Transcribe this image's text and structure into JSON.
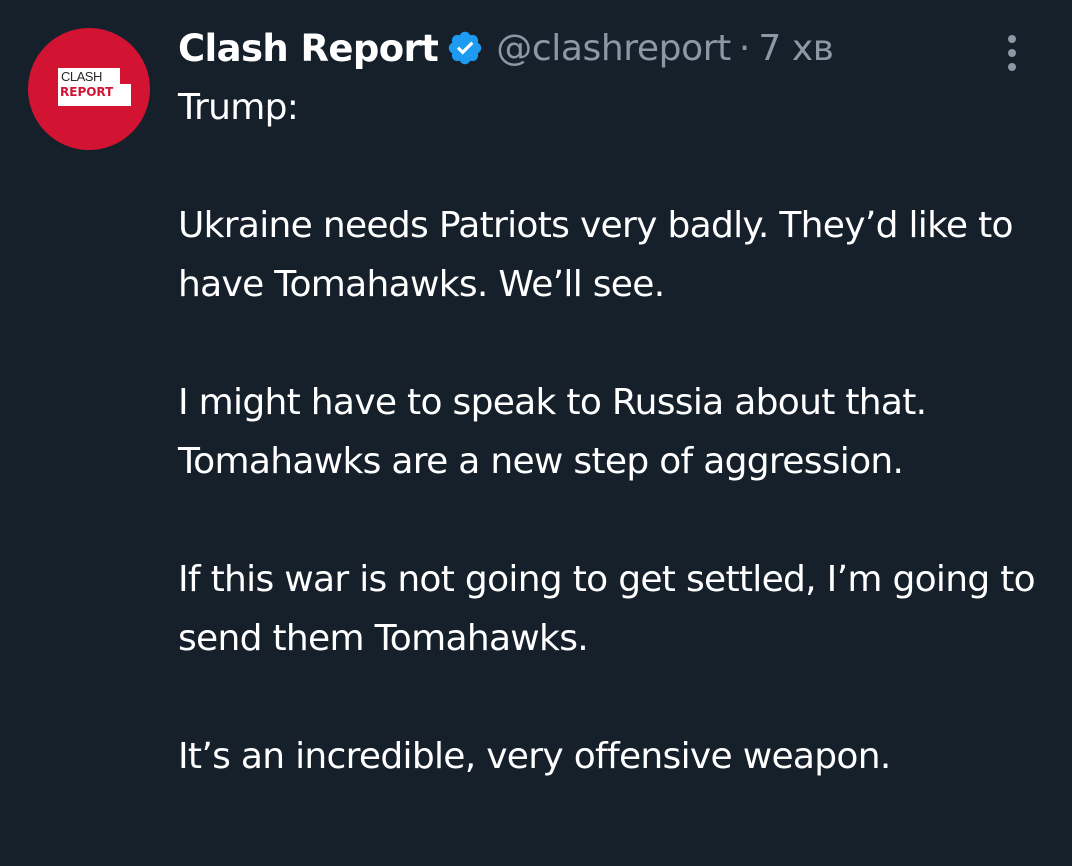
{
  "author": {
    "display_name": "Clash Report",
    "handle": "@clashreport",
    "separator": "·",
    "time": "7 хв",
    "avatar": {
      "line1": "CLASH",
      "line2": "REPORT",
      "brand_color": "#d21432"
    },
    "verified_icon": "verified-badge-icon"
  },
  "tweet": {
    "paragraphs": [
      "Trump:",
      "Ukraine needs Patriots very badly. They’d like to have Tomahawks. We’ll see.",
      "I might have to speak to Russia about that. Tomahawks are a new step of aggression.",
      "If this war is not going to get settled, I’m going to send them Tomahawks.",
      "It’s an incredible, very offensive weapon."
    ]
  },
  "menu_icon": "more-vertical-icon",
  "colors": {
    "background": "#15202b",
    "text": "#ffffff",
    "secondary_text": "#8b98a5",
    "verified": "#1d9bf0"
  }
}
